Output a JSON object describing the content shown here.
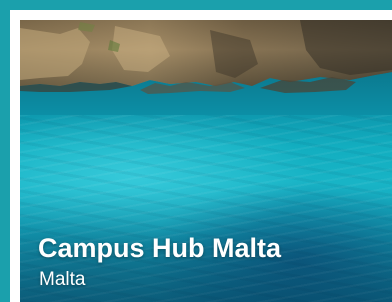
{
  "card": {
    "title": "Campus Hub Malta",
    "location": "Malta",
    "image": "sea-cliffs-photo"
  },
  "colors": {
    "frame": "#1ba0ac",
    "card_border": "#ffffff",
    "text": "#ffffff"
  }
}
